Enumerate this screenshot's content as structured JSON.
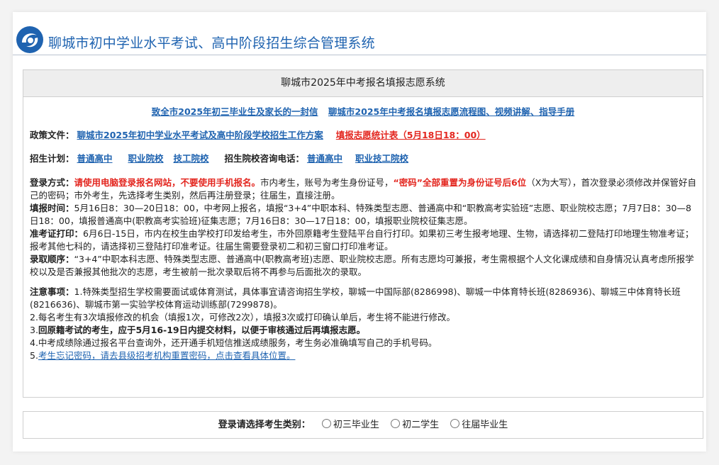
{
  "site": {
    "title": "聊城市初中学业水平考试、高中阶段招生综合管理系统"
  },
  "panel": {
    "title": "聊城市2025年中考报名填报志愿系统",
    "top_links": [
      "致全市2025年初三毕业生及家长的一封信",
      "聊城市2025年中考报名填报志愿流程图、视频讲解、指导手册"
    ],
    "policy": {
      "label": "政策文件：",
      "link1": "聊城市2025年初中学业水平考试及高中阶段学校招生工作方案",
      "link2": "填报志愿统计表（5月18日18：00）"
    },
    "plan": {
      "label": "招生计划：",
      "link_general": "普通高中",
      "link_vocational": "职业院校",
      "link_technical": "技工院校",
      "phone_label": "招生院校咨询电话：",
      "phone_general": "普通高中",
      "phone_vocational": "职业技工院校"
    },
    "login_method": {
      "label": "登录方式：",
      "red1": "请使用电脑登录报名网站，不要使用手机报名。",
      "text1": "市内考生，账号为考生身份证号，",
      "red2": "“密码”全部重置为身份证号后6位",
      "text2": "（X为大写），首次登录必须修改并保管好自己的密码；市外考生，先选择考生类别，然后再注册登录；往届生，直接注册。"
    },
    "fill_time": {
      "label": "填报时间：",
      "text": "5月16日8：30—20日18：00，中考网上报名，填报“3+4”中职本科、特殊类型志愿、普通高中和“职教高考实验班”志愿、职业院校志愿；7月7日8：30—8日18：00，填报普通高中(职教高考实验班)征集志愿；7月16日8：30—17日18：00，填报职业院校征集志愿。"
    },
    "admission_ticket": {
      "label": "准考证打印：",
      "text": "6月6日-15日，市内在校生由学校打印发给考生，市外回原籍考生登陆平台自行打印。如果初三考生报考地理、生物，请选择初二登陆打印地理生物准考证；报考其他七科的，请选择初三登陆打印准考证。往届生需要登录初二和初三窗口打印准考证。"
    },
    "admission_order": {
      "label": "录取顺序：",
      "text": "“3+4”中职本科志愿、特殊类型志愿、普通高中(职教高考班)志愿、职业院校志愿。所有志愿均可兼报，考生需根据个人文化课成绩和自身情况认真考虑所报学校以及是否兼报其他批次的志愿，考生被前一批次录取后将不再参与后面批次的录取。"
    },
    "notes": {
      "label": "注意事项：",
      "item1": "1.特殊类型招生学校需要面试或体育测试，具体事宜请咨询招生学校，聊城一中国际部(8286998)、聊城一中体育特长班(8286936)、聊城三中体育特长班(8216636)、聊城市第一实验学校体育运动训练部(7299878)。",
      "item2": "2.每名考生有3次填报修改的机会（填报1次，可修改2次），填报3次或打印确认单后，考生将不能进行修改。",
      "item3_prefix": "3.",
      "item3_bold": "回原籍考试的考生，应于5月16-19日内提交材料，以便于审核通过后再填报志愿。",
      "item4": "4.中考成绩除通过报名平台查询外，还开通手机短信推送成绩服务，考生务必准确填写自己的手机号码。",
      "item5_prefix": "5.",
      "item5_link": "考生忘记密码，请去县级招考机构重置密码，点击查看具体位置。"
    }
  },
  "login": {
    "label": "登录请选择考生类别：",
    "options": [
      "初三毕业生",
      "初二学生",
      "往届毕业生"
    ]
  },
  "colors": {
    "brand": "#1f63b0",
    "alert": "#e3261f"
  }
}
